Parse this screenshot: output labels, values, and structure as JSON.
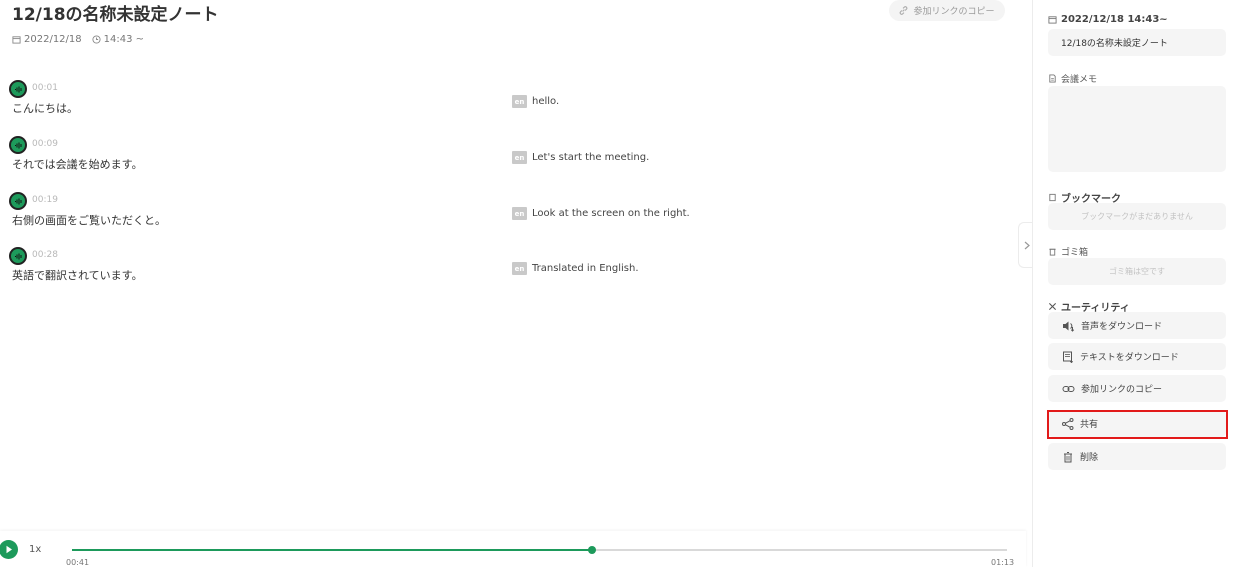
{
  "header": {
    "title": "12/18の名称未設定ノート",
    "copy_link_label": "参加リンクのコピー",
    "date": "2022/12/18",
    "time": "14:43 ~"
  },
  "transcript": [
    {
      "time": "00:01",
      "ja": "こんにちは。",
      "lang": "en",
      "en": "hello."
    },
    {
      "time": "00:09",
      "ja": "それでは会議を始めます。",
      "lang": "en",
      "en": "Let's start the meeting."
    },
    {
      "time": "00:19",
      "ja": "右側の画面をご覧いただくと。",
      "lang": "en",
      "en": "Look at the screen on the right."
    },
    {
      "time": "00:28",
      "ja": "英語で翻訳されています。",
      "lang": "en",
      "en": "Translated in English."
    }
  ],
  "player": {
    "speed": "1x",
    "current": "00:41",
    "total": "01:13",
    "progress": 0.556
  },
  "sidebar": {
    "datetime": "2022/12/18 14:43~",
    "title_value": "12/18の名称未設定ノート",
    "memo_label": "会議メモ",
    "memo_value": "",
    "bookmark_label": "ブックマーク",
    "bookmark_empty": "ブックマークがまだありません",
    "trash_label": "ゴミ箱",
    "trash_empty": "ゴミ箱は空です",
    "utility_label": "ユーティリティ",
    "utilities": [
      {
        "label": "音声をダウンロード",
        "icon": "speaker-download-icon"
      },
      {
        "label": "テキストをダウンロード",
        "icon": "text-download-icon"
      },
      {
        "label": "参加リンクのコピー",
        "icon": "link-icon"
      },
      {
        "label": "共有",
        "icon": "share-icon"
      },
      {
        "label": "削除",
        "icon": "trash-icon"
      }
    ]
  },
  "colors": {
    "accent": "#1d9a5b",
    "highlight": "#e21a1a"
  }
}
